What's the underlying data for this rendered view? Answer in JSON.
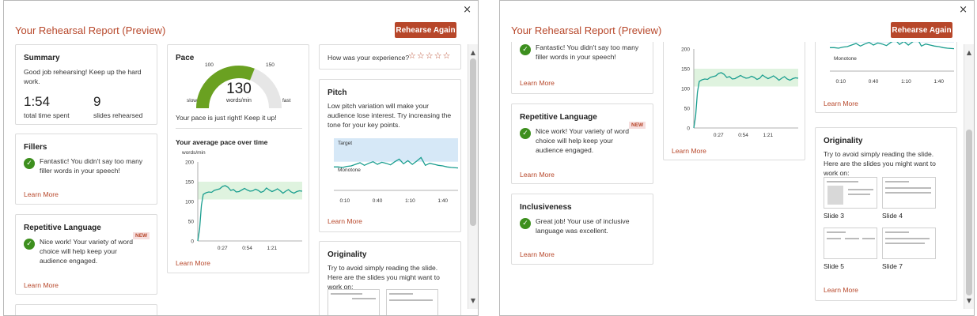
{
  "app": {
    "title": "Your Rehearsal Report (Preview)",
    "rehearse_label": "Rehearse Again",
    "close_glyph": "×"
  },
  "learn_more": "Learn More",
  "summary": {
    "title": "Summary",
    "text": "Good job rehearsing! Keep up the hard work.",
    "time_value": "1:54",
    "time_label": "total time spent",
    "slides_value": "9",
    "slides_label": "slides rehearsed"
  },
  "fillers": {
    "title": "Fillers",
    "text": "Fantastic! You didn't say too many filler words in your speech!"
  },
  "repetitive": {
    "title": "Repetitive Language",
    "badge": "NEW",
    "text": "Nice work! Your variety of word choice will help keep your audience engaged."
  },
  "inclusiveness": {
    "title": "Inclusiveness",
    "text": "Great job! Your use of inclusive language was excellent."
  },
  "pace": {
    "title": "Pace",
    "value": "130",
    "unit": "words/min",
    "gauge_min_label": "slow",
    "gauge_max_label": "fast",
    "gauge_low_tick": "100",
    "gauge_high_tick": "150",
    "gauge_fraction": 0.62,
    "message": "Your pace is just right! Keep it up!",
    "chart_title": "Your average pace over time"
  },
  "experience": {
    "question": "How was your experience?",
    "stars": "☆☆☆☆☆"
  },
  "pitch": {
    "title": "Pitch",
    "text": "Low pitch variation will make your audience lose interest. Try increasing the tone for your key points.",
    "target_label": "Target",
    "monotone_label": "Monotone"
  },
  "originality": {
    "title": "Originality",
    "text": "Try to avoid simply reading the slide. Here are the slides you might want to work on:",
    "slides": [
      "Slide 3",
      "Slide 4",
      "Slide 5",
      "Slide 7"
    ]
  },
  "colors": {
    "accent": "#b7472a",
    "success": "#3d8f1e",
    "gauge": "#6aa121",
    "line": "#1a9e8f",
    "band_green": "#dff3df",
    "band_blue": "#d6e8f7"
  },
  "chart_data": [
    {
      "type": "line",
      "ylabel": "words/min",
      "yticks": [
        0,
        50,
        100,
        150,
        200
      ],
      "ylim": [
        0,
        200
      ],
      "xticks": [
        "0:27",
        "0:54",
        "1:21"
      ],
      "xlim": [
        0,
        114
      ],
      "target_band": [
        105,
        150
      ],
      "x": [
        0,
        2,
        4,
        6,
        9,
        12,
        15,
        18,
        21,
        24,
        27,
        30,
        33,
        36,
        39,
        42,
        45,
        48,
        51,
        54,
        57,
        60,
        63,
        66,
        69,
        72,
        75,
        78,
        81,
        84,
        87,
        90,
        93,
        96,
        99,
        102,
        105,
        108,
        111,
        114
      ],
      "y": [
        0,
        30,
        90,
        118,
        122,
        124,
        123,
        128,
        130,
        132,
        138,
        140,
        136,
        128,
        130,
        124,
        125,
        129,
        133,
        129,
        126,
        127,
        131,
        128,
        123,
        126,
        134,
        129,
        125,
        128,
        132,
        127,
        121,
        126,
        130,
        124,
        121,
        125,
        127,
        126
      ]
    },
    {
      "type": "line",
      "xticks": [
        "0:10",
        "0:40",
        "1:10",
        "1:40"
      ],
      "xlim": [
        0,
        114
      ],
      "ylim": [
        0,
        100
      ],
      "band_labels": [
        "Target",
        "Monotone"
      ],
      "target_band": [
        55,
        100
      ],
      "x": [
        0,
        4,
        8,
        12,
        16,
        20,
        24,
        28,
        32,
        36,
        40,
        44,
        48,
        52,
        56,
        60,
        64,
        68,
        72,
        76,
        80,
        84,
        88,
        92,
        96,
        100,
        104,
        108,
        114
      ],
      "y": [
        45,
        45,
        44,
        46,
        47,
        50,
        53,
        48,
        52,
        55,
        50,
        54,
        52,
        49,
        55,
        60,
        51,
        57,
        50,
        56,
        63,
        48,
        52,
        50,
        48,
        47,
        45,
        44,
        43
      ]
    }
  ]
}
